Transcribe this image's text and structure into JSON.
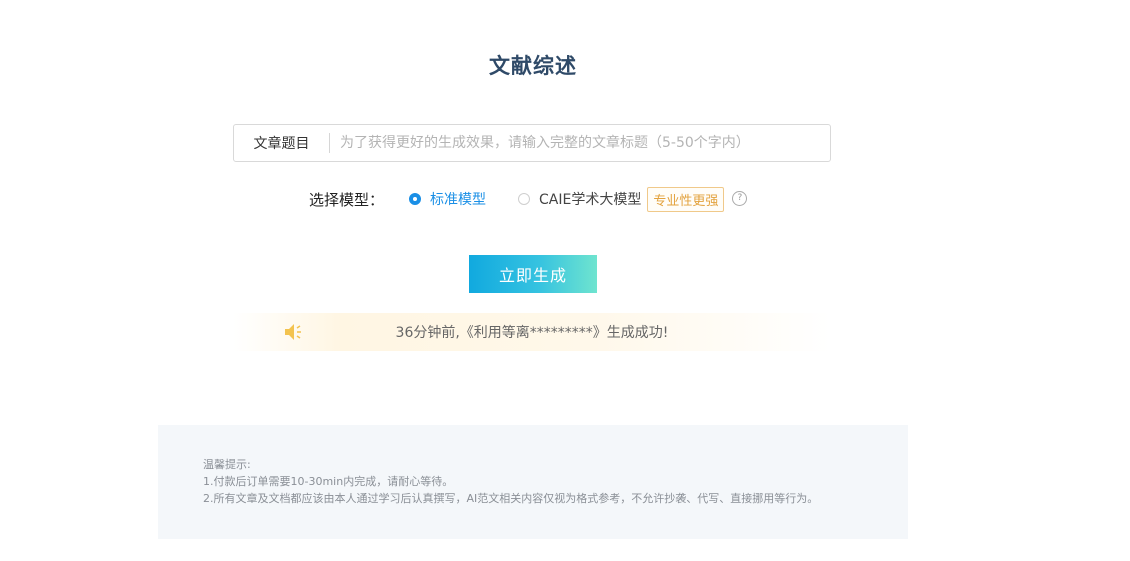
{
  "page": {
    "title": "文献综述"
  },
  "title_field": {
    "label": "文章题目",
    "placeholder": "为了获得更好的生成效果，请输入完整的文章标题（5-50个字内）",
    "value": ""
  },
  "model_select": {
    "label": "选择模型：",
    "options": [
      {
        "label": "标准模型",
        "selected": true
      },
      {
        "label": "CAIE学术大模型",
        "selected": false
      }
    ],
    "badge": "专业性更强",
    "help_icon": "question-circle-icon"
  },
  "actions": {
    "generate_label": "立即生成"
  },
  "notice": {
    "icon": "speaker-icon",
    "text": "36分钟前,《利用等离*********》生成成功!"
  },
  "tips": {
    "heading": "温馨提示:",
    "lines": [
      "1.付款后订单需要10-30min内完成，请耐心等待。",
      "2.所有文章及文档都应该由本人通过学习后认真撰写，AI范文相关内容仅视为格式参考，不允许抄袭、代写、直接挪用等行为。"
    ]
  },
  "colors": {
    "accent_blue": "#1a8fe6",
    "button_gradient_start": "#11a9df",
    "button_gradient_end": "#6fe4cf",
    "badge_orange": "#e3a23d",
    "notice_bg": "#fff6e3",
    "tips_bg": "#f4f7fa",
    "title_color": "#2f4a68"
  }
}
